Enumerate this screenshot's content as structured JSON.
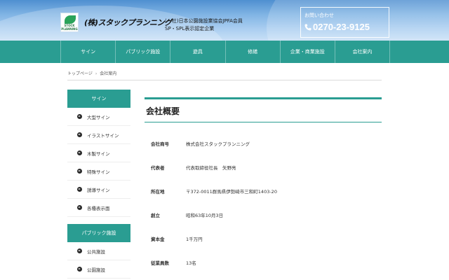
{
  "header": {
    "logo_text": "STOCK PLANNING",
    "brand": "(株)スタックプランニング",
    "association_line1": "(一社)日本公園施設業協会JPFA会員",
    "association_line2": "SP・SPL表示認定企業",
    "contact_label": "お問い合わせ",
    "phone": "0270-23-9125"
  },
  "nav": {
    "items": [
      "サイン",
      "パブリック施設",
      "遊具",
      "修繕",
      "企業・商業施設",
      "会社案内"
    ]
  },
  "breadcrumb": {
    "home": "トップページ",
    "separator": "›",
    "current": "会社案内"
  },
  "sidebar": {
    "section1_title": "サイン",
    "section1_items": [
      "大型サイン",
      "イラストサイン",
      "木製サイン",
      "特殊サイン",
      "誘導サイン",
      "各種表示面"
    ],
    "section2_title": "パブリック施設",
    "section2_items": [
      "公共施設",
      "公園施設"
    ]
  },
  "main": {
    "title": "会社概要",
    "rows": [
      {
        "label": "会社商号",
        "value": "株式会社スタックプランニング"
      },
      {
        "label": "代表者",
        "value": "代表取締役社長　矢野亮"
      },
      {
        "label": "所在地",
        "value": "〒372-0011群馬県伊勢崎市三和町1403-20"
      },
      {
        "label": "創立",
        "value": "昭和63年10月3日"
      },
      {
        "label": "資本金",
        "value": "1千万円"
      },
      {
        "label": "従業員数",
        "value": "13名"
      }
    ]
  },
  "colors": {
    "teal": "#2a9d92",
    "header_blue": "#7fb3e4"
  }
}
